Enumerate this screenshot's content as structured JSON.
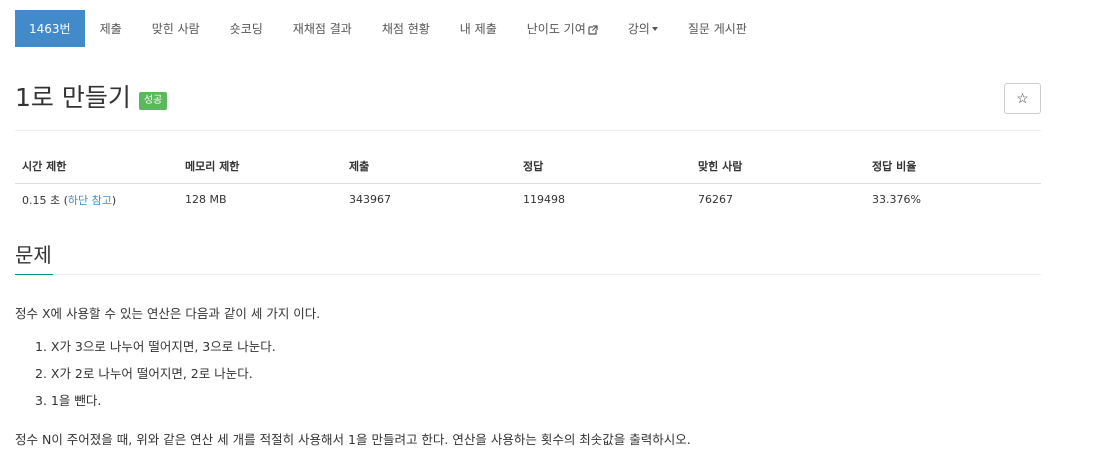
{
  "nav": {
    "items": [
      {
        "label": "1463번",
        "active": true
      },
      {
        "label": "제출"
      },
      {
        "label": "맞힌 사람"
      },
      {
        "label": "숏코딩"
      },
      {
        "label": "재채점 결과"
      },
      {
        "label": "채점 현황"
      },
      {
        "label": "내 제출"
      },
      {
        "label": "난이도 기여",
        "icon": "external-link-icon"
      },
      {
        "label": "강의",
        "icon": "caret-down-icon"
      },
      {
        "label": "질문 게시판"
      }
    ]
  },
  "problem": {
    "title": "1로 만들기",
    "badge": "성공",
    "star_icon": "☆"
  },
  "info_table": {
    "headers": [
      "시간 제한",
      "메모리 제한",
      "제출",
      "정답",
      "맞힌 사람",
      "정답 비율"
    ],
    "time_limit_value": "0.15 초 (",
    "time_limit_link": "하단 참고",
    "time_limit_close": ")",
    "memory_limit": "128 MB",
    "submissions": "343967",
    "accepted": "119498",
    "solvers": "76267",
    "ratio": "33.376%"
  },
  "section": {
    "title": "문제",
    "intro": "정수 X에 사용할 수 있는 연산은 다음과 같이 세 가지 이다.",
    "operations": [
      "1. X가 3으로 나누어 떨어지면, 3으로 나눈다.",
      "2. X가 2로 나누어 떨어지면, 2로 나눈다.",
      "3. 1을 뺀다."
    ],
    "statement": "정수 N이 주어졌을 때, 위와 같은 연산 세 개를 적절히 사용해서 1을 만들려고 한다. 연산을 사용하는 횟수의 최솟값을 출력하시오."
  },
  "colors": {
    "accent": "#428bca",
    "success": "#5cb85c",
    "section_underline": "#009688"
  }
}
